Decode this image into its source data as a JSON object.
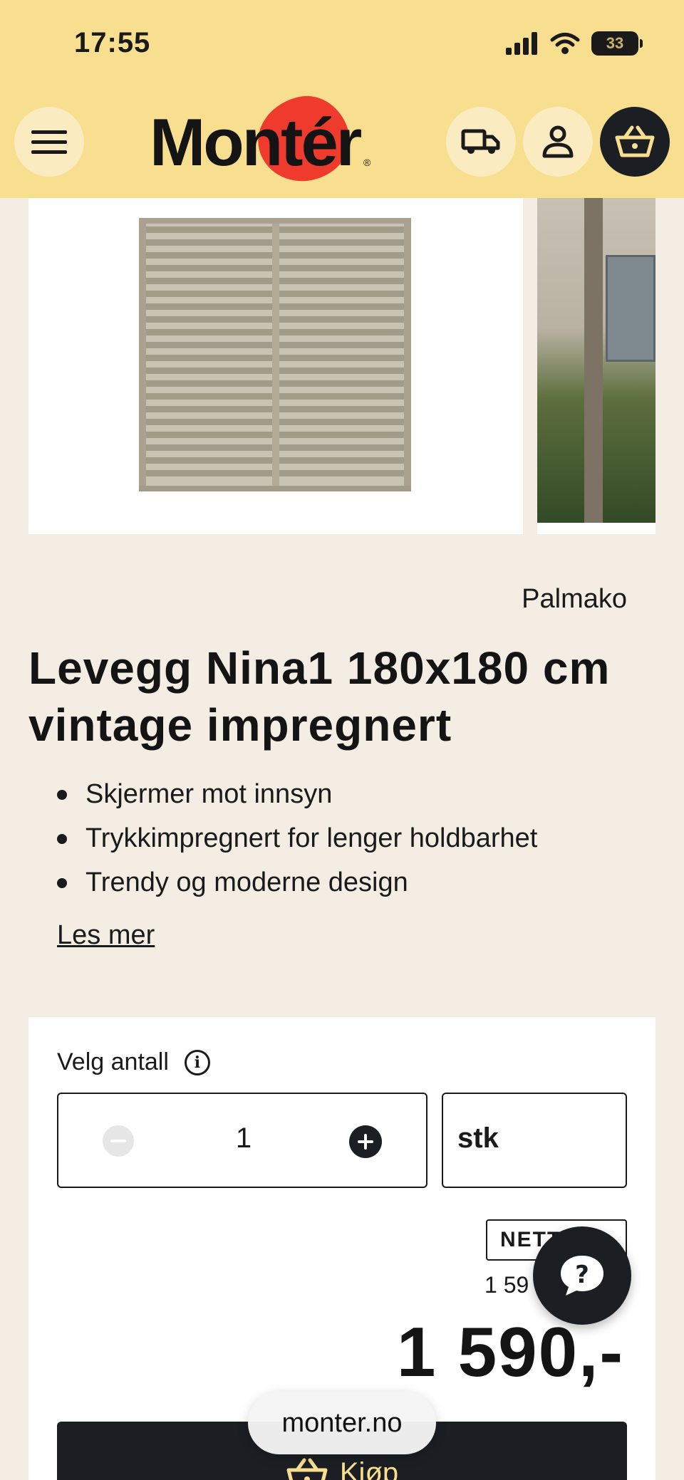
{
  "status_bar": {
    "time": "17:55",
    "battery": "33"
  },
  "header": {
    "logo_text": "Montér",
    "menu_icon": "hamburger-icon",
    "delivery_icon": "truck-icon",
    "account_icon": "user-icon",
    "cart_icon": "basket-icon"
  },
  "product": {
    "brand": "Palmako",
    "title": "Levegg Nina1 180x180 cm vintage impregnert",
    "bullets": [
      "Skjermer mot innsyn",
      "Trykkimpregnert for lenger holdbarhet",
      "Trendy og moderne design"
    ],
    "read_more": "Les mer"
  },
  "purchase": {
    "quantity_label": "Velg antall",
    "quantity_value": "1",
    "unit": "stk",
    "net_badge": "NETT",
    "old_price_partial": "1 59",
    "price": "1 590,-",
    "buy_label": "Kjøp"
  },
  "browser": {
    "url": "monter.no"
  },
  "colors": {
    "header_bg": "#f8de8f",
    "page_bg": "#f4ede4",
    "brand_red": "#ef3b2d",
    "dark": "#1b1f24"
  }
}
